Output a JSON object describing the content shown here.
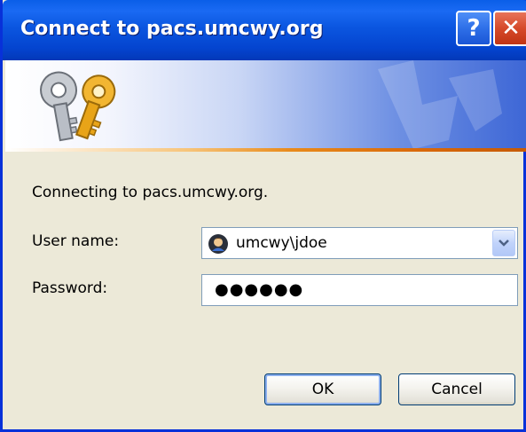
{
  "window": {
    "title": "Connect to pacs.umcwy.org",
    "help_button_label": "?",
    "close_button_label": "✕"
  },
  "banner": {
    "icon": "keys-icon"
  },
  "dialog": {
    "message": "Connecting to pacs.umcwy.org.",
    "username_label": "User name:",
    "username_value": "umcwy\\jdoe",
    "username_icon": "user-icon",
    "password_label": "Password:",
    "password_masked": "●●●●●●",
    "ok_label": "OK",
    "cancel_label": "Cancel"
  },
  "colors": {
    "titlebar": "#0a5ee8",
    "window_bg": "#ece9d8",
    "accent_line": "#e88a1a"
  }
}
